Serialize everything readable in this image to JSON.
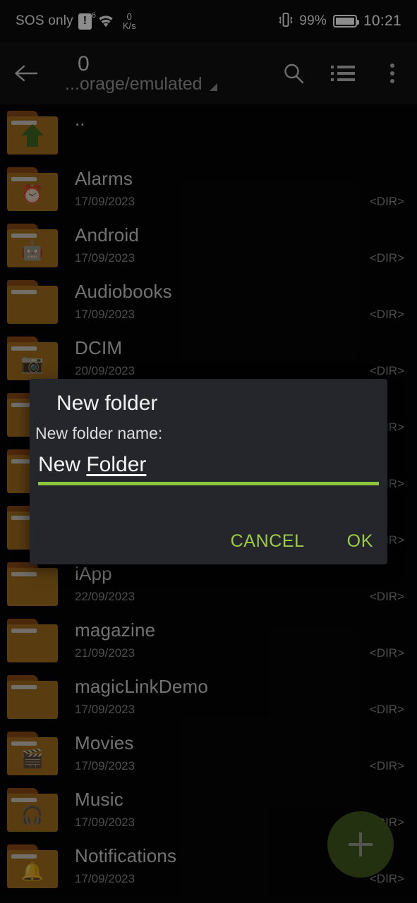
{
  "status_bar": {
    "carrier": "SOS only",
    "sim_badge": "!",
    "wifi_superscript": "6",
    "net_speed_value": "0",
    "net_speed_unit": "K/s",
    "vibrate_icon": "vibrate-icon",
    "battery_percent": "99%",
    "clock": "10:21"
  },
  "toolbar": {
    "back_icon": "back-arrow-icon",
    "title": "0",
    "subtitle": "...orage/emulated",
    "caret_icon": "dropdown-caret-icon",
    "search_icon": "search-icon",
    "view_icon": "list-view-icon",
    "overflow_icon": "overflow-menu-icon"
  },
  "file_list": {
    "dir_label": "<DIR>",
    "items": [
      {
        "name": "..",
        "date": "",
        "size": "",
        "icon": "folder-up-icon",
        "glyph": ""
      },
      {
        "name": "Alarms",
        "date": "17/09/2023",
        "size": "<DIR>",
        "icon": "folder-alarm-icon",
        "glyph": "⏰"
      },
      {
        "name": "Android",
        "date": "17/09/2023",
        "size": "<DIR>",
        "icon": "folder-android-icon",
        "glyph": "🤖"
      },
      {
        "name": "Audiobooks",
        "date": "17/09/2023",
        "size": "<DIR>",
        "icon": "folder-icon",
        "glyph": ""
      },
      {
        "name": "DCIM",
        "date": "20/09/2023",
        "size": "<DIR>",
        "icon": "folder-camera-icon",
        "glyph": "📷"
      },
      {
        "name": "",
        "date": "",
        "size": "<DIR>",
        "icon": "folder-icon",
        "glyph": ""
      },
      {
        "name": "",
        "date": "",
        "size": "<DIR>",
        "icon": "folder-icon",
        "glyph": ""
      },
      {
        "name": "",
        "date": "",
        "size": "<DIR>",
        "icon": "folder-icon",
        "glyph": ""
      },
      {
        "name": "iApp",
        "date": "22/09/2023",
        "size": "<DIR>",
        "icon": "folder-icon",
        "glyph": ""
      },
      {
        "name": "magazine",
        "date": "21/09/2023",
        "size": "<DIR>",
        "icon": "folder-icon",
        "glyph": ""
      },
      {
        "name": "magicLinkDemo",
        "date": "17/09/2023",
        "size": "<DIR>",
        "icon": "folder-icon",
        "glyph": ""
      },
      {
        "name": "Movies",
        "date": "17/09/2023",
        "size": "<DIR>",
        "icon": "folder-movies-icon",
        "glyph": "🎬"
      },
      {
        "name": "Music",
        "date": "17/09/2023",
        "size": "<DIR>",
        "icon": "folder-music-icon",
        "glyph": "🎧"
      },
      {
        "name": "Notifications",
        "date": "17/09/2023",
        "size": "<DIR>",
        "icon": "folder-bell-icon",
        "glyph": "🔔"
      }
    ]
  },
  "fab": {
    "icon": "plus-icon",
    "color": "#42591f"
  },
  "dialog": {
    "title": "New folder",
    "label": "New folder name:",
    "input_value_plain": "New ",
    "input_value_composed": "Folder",
    "input_value": "New Folder",
    "underline_color": "#8cc63f",
    "cancel_label": "CANCEL",
    "ok_label": "OK",
    "accent_color": "#9ccc45"
  }
}
